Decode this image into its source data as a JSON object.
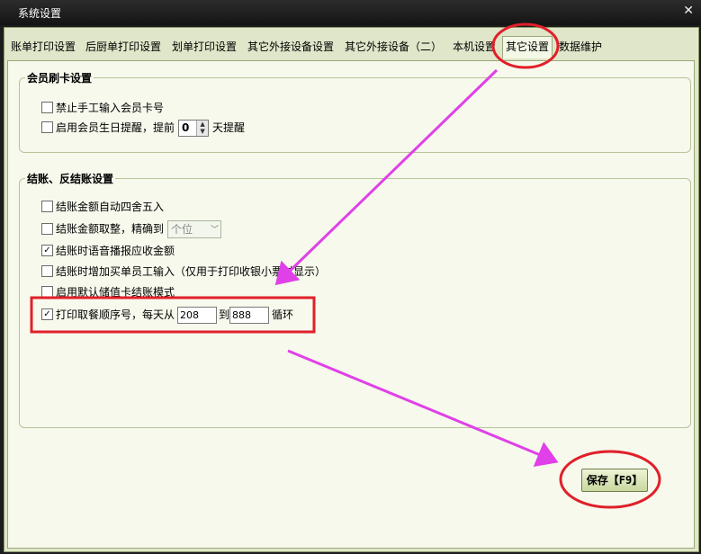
{
  "window": {
    "title": "系统设置",
    "close_glyph": "✕"
  },
  "tabs": [
    "账单打印设置",
    "后厨单打印设置",
    "划单打印设置",
    "其它外接设备设置",
    "其它外接设备（二）",
    "本机设置",
    "其它设置",
    "数据维护"
  ],
  "active_tab_index": 6,
  "member_group": {
    "title": "会员刷卡设置",
    "disable_manual_card": {
      "label": "禁止手工输入会员卡号",
      "checked": false
    },
    "birthday_reminder": {
      "label": "启用会员生日提醒，提前",
      "checked": false,
      "value": "0",
      "suffix": "天提醒"
    }
  },
  "checkout_group": {
    "title": "结账、反结账设置",
    "round_amount": {
      "label": "结账金额自动四舍五入",
      "checked": false
    },
    "integer_amount": {
      "label": "结账金额取整，精确到",
      "checked": false,
      "select_value": "个位"
    },
    "voice_announce": {
      "label": "结账时语音播报应收金额",
      "checked": true
    },
    "add_staff_input": {
      "label": "结账时增加买单员工输入（仅用于打印收银小票时显示）",
      "checked": false
    },
    "stored_value_mode": {
      "label": "启用默认储值卡结账模式",
      "checked": false
    },
    "order_number": {
      "label": "打印取餐顺序号，每天从",
      "checked": true,
      "from": "208",
      "mid": "到",
      "to": "888",
      "suffix": "循环"
    }
  },
  "save_button": {
    "label": "保存【F9】"
  },
  "annotation_colors": {
    "circle": "#e0202a",
    "arrow": "#e040e8"
  }
}
